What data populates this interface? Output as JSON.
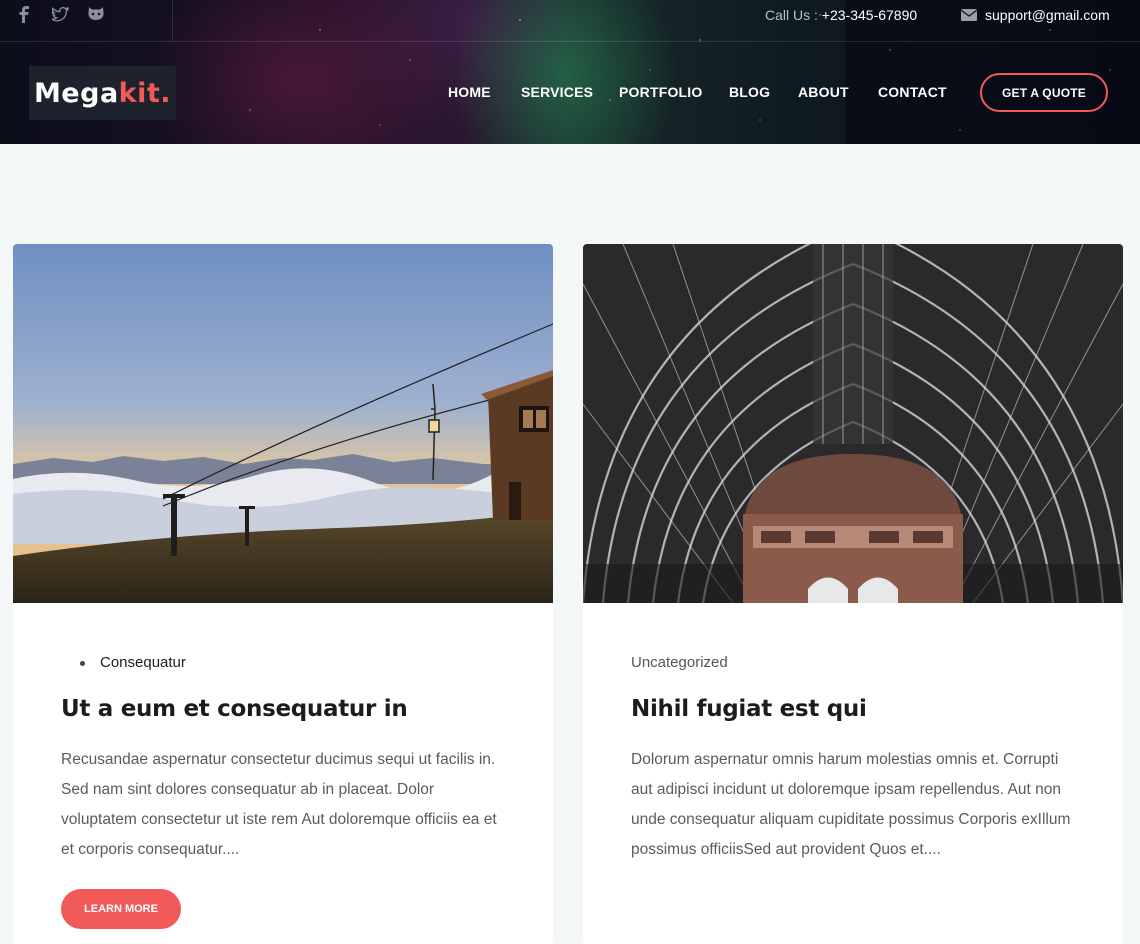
{
  "topbar": {
    "social": [
      {
        "icon": "facebook-icon"
      },
      {
        "icon": "twitter-icon"
      },
      {
        "icon": "github-icon"
      }
    ],
    "call_label": "Call Us :",
    "call_number": "+23-345-67890",
    "email": "support@gmail.com"
  },
  "logo": {
    "part1": "Mega",
    "part2": "kit."
  },
  "nav": {
    "items": [
      "HOME",
      "SERVICES",
      "PORTFOLIO",
      "BLOG",
      "ABOUT",
      "CONTACT"
    ],
    "quote_label": "GET A QUOTE"
  },
  "colors": {
    "accent": "#f25a5a",
    "background": "#f4f7f8",
    "header_dark": "#0c0e1a"
  },
  "posts": [
    {
      "category": "Consequatur",
      "title": "Ut a eum et consequatur in",
      "excerpt": "Recusandae aspernatur consectetur ducimus sequi ut facilis in. Sed nam sint dolores consequatur ab in placeat. Dolor voluptatem consectetur ut iste rem Aut doloremque officiis ea et et corporis consequatur....",
      "button": "LEARN MORE"
    },
    {
      "category": "Uncategorized",
      "title": "Nihil fugiat est qui",
      "excerpt": "Dolorum aspernatur omnis harum molestias omnis et. Corrupti aut adipisci incidunt ut doloremque ipsam repellendus. Aut non unde consequatur aliquam cupiditate possimus Corporis exIllum possimus officiisSed aut provident Quos et...."
    }
  ]
}
